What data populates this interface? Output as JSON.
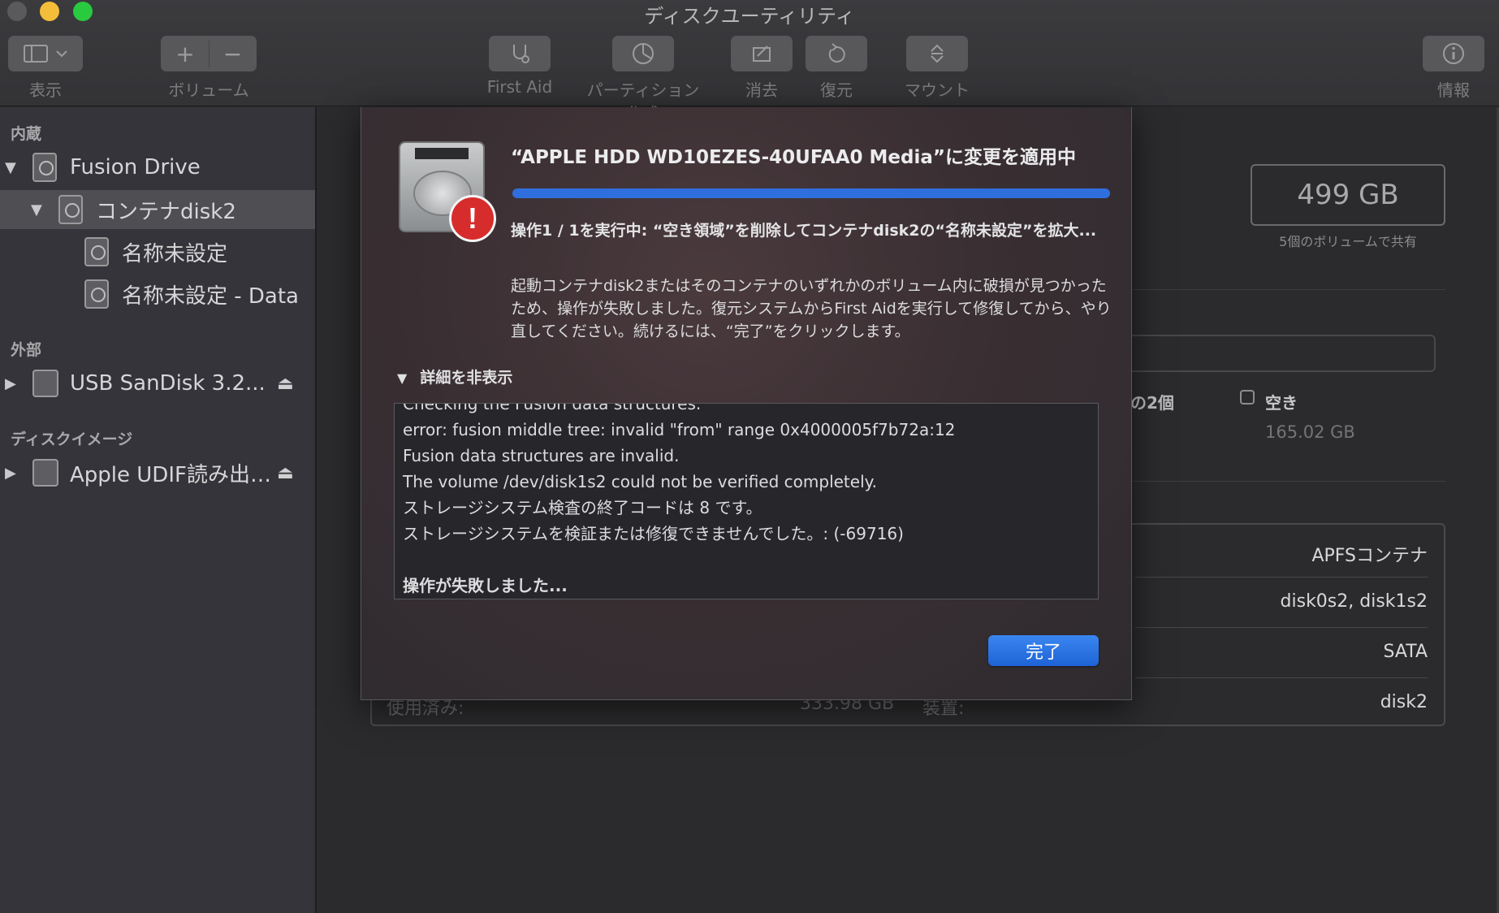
{
  "window": {
    "title": "ディスクユーティリティ"
  },
  "toolbar": {
    "view_label": "表示",
    "volume_label": "ボリューム",
    "first_aid_label": "First Aid",
    "partition_label": "パーティション作成",
    "erase_label": "消去",
    "restore_label": "復元",
    "mount_label": "マウント",
    "info_label": "情報"
  },
  "sidebar": {
    "section_internal": "内蔵",
    "section_external": "外部",
    "section_images": "ディスクイメージ",
    "items": [
      {
        "label": "Fusion Drive"
      },
      {
        "label": "コンテナdisk2"
      },
      {
        "label": "名称未設定"
      },
      {
        "label": "名称未設定 - Data"
      },
      {
        "label": "USB SanDisk 3.2..."
      },
      {
        "label": "Apple UDIF読み出…"
      }
    ]
  },
  "main": {
    "capacity": "499 GB",
    "capacity_sub": "5個のボリュームで共有",
    "other_label": "の2個",
    "free_label": "空き",
    "free_value": "165.02 GB",
    "info_rows": [
      "APFSコンテナ",
      "disk0s2, disk1s2",
      "SATA",
      "disk2"
    ],
    "peek_used_label": "使用済み:",
    "peek_used_value": "333.98 GB",
    "peek_device_label": "装置:"
  },
  "dialog": {
    "title": "“APPLE HDD WD10EZES-40UFAA0 Media”に変更を適用中",
    "progress_fraction": 1.0,
    "subtitle": "操作1 / 1を実行中: “空き領域”を削除してコンテナdisk2の“名称未設定”を拡大...",
    "body": "起動コンテナdisk2またはそのコンテナのいずれかのボリューム内に破損が見つかったため、操作が失敗しました。復元システムからFirst Aidを実行して修復してから、やり直してください。続けるには、“完了”をクリックします。",
    "details_toggle": "詳細を非表示",
    "log": [
      "Checking the Fusion data structures.",
      "error: fusion middle tree: invalid \"from\" range 0x4000005f7b72a:12",
      "Fusion data structures are invalid.",
      "The volume /dev/disk1s2 could not be verified completely.",
      "ストレージシステム検査の終了コードは 8 です。",
      "ストレージシステムを検証または修復できませんでした。: (-69716)",
      "",
      "操作が失敗しました..."
    ],
    "done_label": "完了"
  },
  "colors": {
    "accent": "#2f6fdd",
    "error": "#d72c2c"
  }
}
